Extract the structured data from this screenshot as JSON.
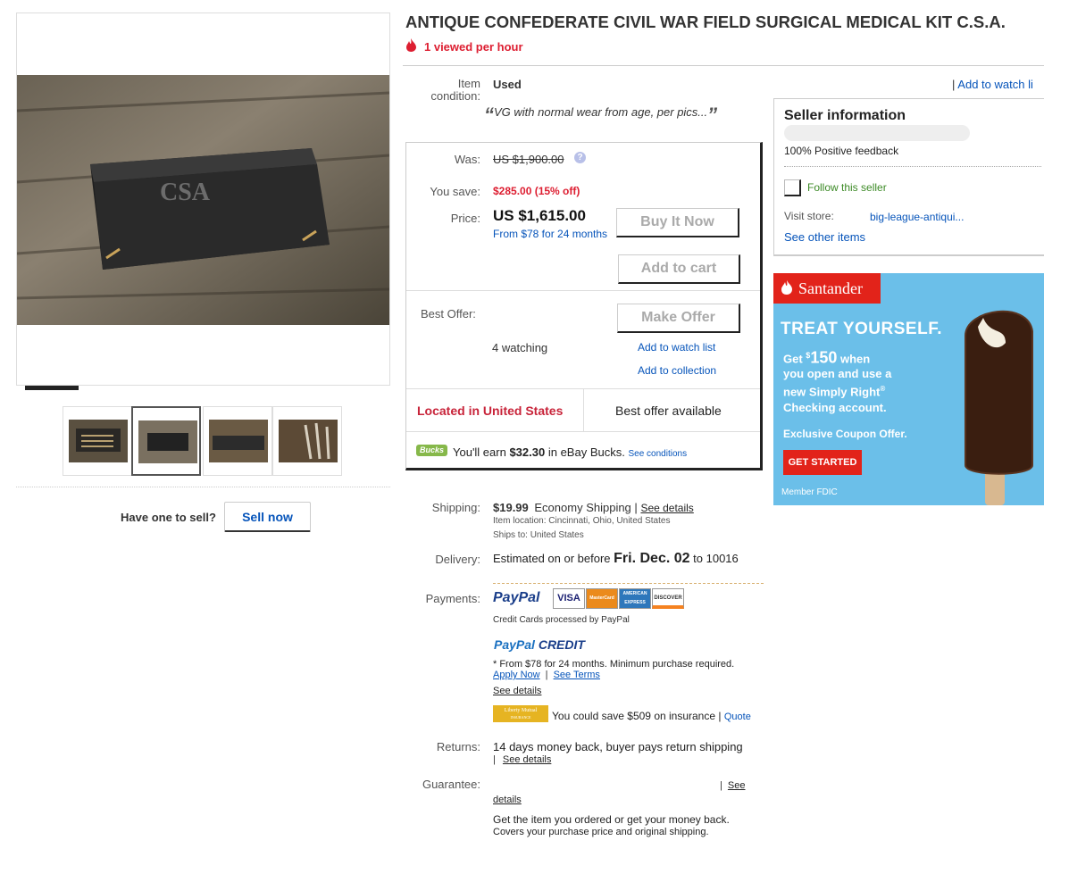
{
  "title": "ANTIQUE CONFEDERATE CIVIL WAR FIELD SURGICAL MEDICAL KIT C.S.A.",
  "views": "1 viewed per hour",
  "condition": {
    "label_line1": "Item",
    "label_line2": "condition:",
    "value": "Used",
    "note": "VG with normal wear from age, per pics...",
    "open_quote": "“",
    "close_quote": "”"
  },
  "watch_top": {
    "sep": "|",
    "link": "Add to watch li"
  },
  "price": {
    "was_label": "Was:",
    "was_value": "US $1,900.00",
    "save_label": "You save:",
    "save_value": "$285.00 (15% off)",
    "price_label": "Price:",
    "price_value": "US $1,615.00",
    "financing": "From $78 for 24 months",
    "buy_now": "Buy It Now",
    "add_cart": "Add to cart",
    "best_offer_label": "Best Offer:",
    "make_offer": "Make Offer",
    "watching": "4 watching",
    "add_watch": "Add to watch list",
    "add_collection": "Add to collection",
    "location": "Located in United States",
    "best_offer_available": "Best offer available",
    "bucks_badge": "Bucks",
    "bucks_pre": "You'll earn",
    "bucks_amount": "$32.30",
    "bucks_post": "in eBay Bucks.",
    "bucks_link": "See conditions"
  },
  "seller": {
    "heading": "Seller information",
    "feedback": "100% Positive feedback",
    "follow": "Follow this seller",
    "visit_label": "Visit store:",
    "store_name": "big-league-antiqui...",
    "see_other": "See other items"
  },
  "ad": {
    "brand": "Santander",
    "headline": "TREAT YOURSELF.",
    "get": "Get",
    "dollar": "$",
    "amount": "150",
    "when": "when",
    "line2": "you open and use a",
    "line3": "new Simply Right",
    "reg": "®",
    "line4": "Checking account.",
    "coupon": "Exclusive Coupon Offer.",
    "cta": "GET STARTED",
    "fdic": "Member FDIC",
    "colors": {
      "bg": "#6bbfe9",
      "red": "#e2231a"
    }
  },
  "sell": {
    "prompt": "Have one to sell?",
    "button": "Sell now"
  },
  "shipping": {
    "label": "Shipping:",
    "cost": "$19.99",
    "method": "Economy Shipping",
    "sep": "|",
    "details": "See details",
    "location_label": "Item location:",
    "location": "Cincinnati, Ohio, United States",
    "ships_label": "Ships to:",
    "ships_to": "United States"
  },
  "delivery": {
    "label": "Delivery:",
    "pre": "Estimated on or before",
    "date": "Fri. Dec. 02",
    "post": "to 10016"
  },
  "payments": {
    "label": "Payments:",
    "paypal": "PayPal",
    "cards": [
      "VISA",
      "MasterCard",
      "AMERICAN EXPRESS",
      "DISCOVER"
    ],
    "processed": "Credit Cards processed by PayPal",
    "credit_logo_a": "PayPal",
    "credit_logo_b": "CREDIT",
    "credit_note": "* From $78 for 24 months. Minimum purchase required.",
    "apply": "Apply Now",
    "sep": "|",
    "terms": "See Terms",
    "see_details": "See details",
    "insurance_badge": "Liberty Mutual",
    "insurance_badge_sub": "INSURANCE",
    "insurance": "You could save $509 on insurance",
    "insurance_sep": "|",
    "quote": "Quote"
  },
  "returns": {
    "label": "Returns:",
    "text": "14 days money back, buyer pays return shipping",
    "sep": "|",
    "link": "See details"
  },
  "guarantee": {
    "label": "Guarantee:",
    "sep": "|",
    "link_a": "See",
    "link_b": "details",
    "text1": "Get the item you ordered or get your money back.",
    "text2": "Covers your purchase price and original shipping."
  }
}
